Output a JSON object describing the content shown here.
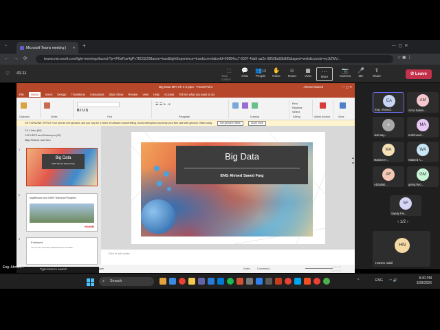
{
  "browser": {
    "tab_title": "Microsoft Teams meeting |",
    "new_tab": "+",
    "url": "teams.microsoft.com/light-meetings/launch?p=iFEaPue4gPv78C0ZZ98anon=true&lightExperience=true&correlationId=90984cc7-6307-4da5-aa2e-38538a83b895&agent=web&coords=eyJtZWV...",
    "nav": {
      "back": "←",
      "forward": "→",
      "reload": "⟳"
    }
  },
  "meeting": {
    "timer": "41:11",
    "controls": [
      {
        "label": "Take control",
        "glyph": "⬚"
      },
      {
        "label": "Chat",
        "glyph": "💬"
      },
      {
        "label": "People",
        "glyph": "👥"
      },
      {
        "label": "Raise",
        "glyph": "✋"
      },
      {
        "label": "React",
        "glyph": "☺"
      },
      {
        "label": "View",
        "glyph": "▦"
      },
      {
        "label": "More",
        "glyph": "⋯"
      },
      {
        "label": "Camera",
        "glyph": "📷"
      },
      {
        "label": "Mic",
        "glyph": "🎤"
      },
      {
        "label": "Share",
        "glyph": "⇪"
      }
    ],
    "people_count": "13",
    "leave_label": "Leave"
  },
  "ppt": {
    "window_title": "Big Data MFI Ch 1-2.pptx  -  PowerPoint",
    "user": "Ahmed Saeed",
    "tabs": [
      "File",
      "Home",
      "Insert",
      "Design",
      "Transitions",
      "Animations",
      "Slide Show",
      "Review",
      "View",
      "Help",
      "Acrobat",
      "Tell me what you want to do"
    ],
    "active_tab": "Home",
    "ribbon_groups": [
      "Clipboard",
      "Slides",
      "Font",
      "Paragraph",
      "Drawing",
      "Editing",
      "Adobe Acrobat",
      "Voice"
    ],
    "banner_text": "GET GENUINE OFFICE  Your license isn't genuine, and you may be a victim of software counterfeiting. Avoid interruption and keep your files safe with genuine Office today.",
    "banner_btn1": "Get genuine Office",
    "banner_btn2": "Learn more",
    "outline": [
      "Ch 1 Intro (00)",
      "Ch2 HDFS and Zookeeper (00)",
      "Map Reduce and Yarn"
    ],
    "thumbs": [
      {
        "num": "1",
        "title": "Big Data",
        "sub": "ENG Ahmed Saeed Farg"
      },
      {
        "num": "2",
        "title": "MapReduce and YARN Technical Principles",
        "brand": "HUAWEI"
      },
      {
        "num": "3",
        "title": "Foreword",
        "body": "The course describes MapReduce and YARN..."
      }
    ],
    "slide": {
      "title": "Big Data",
      "subtitle": "ENG Ahmed Saeed Farg"
    },
    "notes_placeholder": "Click to add notes",
    "status": {
      "slide": "Slide 1 of 232",
      "lang": "English (United States)",
      "access": "Accessibility: Investigate",
      "notes": "Notes",
      "comments": "Comments"
    }
  },
  "participants": [
    {
      "initials": "EA",
      "name": "Eng. Ahmed...",
      "color": "#c7d6f5",
      "active": true
    },
    {
      "initials": "AM",
      "name": "Azza Salem...",
      "color": "#f5c7cf"
    },
    {
      "initials": "",
      "name": "Just say...",
      "color": "#aaaaaa"
    },
    {
      "initials": "MA",
      "name": "mahmoud...",
      "color": "#e9c7f5"
    },
    {
      "initials": "MA",
      "name": "Mariam H...",
      "color": "#f5e1b5"
    },
    {
      "initials": "WA",
      "name": "Waleed A...",
      "color": "#c7e6f5"
    },
    {
      "initials": "AF",
      "name": "Abdallah...",
      "color": "#f5c7b5"
    },
    {
      "initials": "GM",
      "name": "gehad Mo...",
      "color": "#c7f5d5"
    },
    {
      "initials": "SF",
      "name": "Saedy Fer...",
      "color": "#d5d5f5"
    }
  ],
  "pager": "1/2",
  "big_tile": {
    "initials": "HN",
    "name": "Hazem nabil",
    "color": "#f5d9a5"
  },
  "self_label": "Eng. Ahmed...",
  "taskbar": {
    "search": "Search",
    "type_here": "Type here to search",
    "lang": "ENG",
    "time": "8:30 PM",
    "date": "3/28/2026",
    "inner_time": "8:33 PM",
    "inner_date": "3/28/2026"
  },
  "colors": {
    "accent": "#b7472a",
    "teams": "#5b5fc7",
    "leave": "#c4314b"
  }
}
